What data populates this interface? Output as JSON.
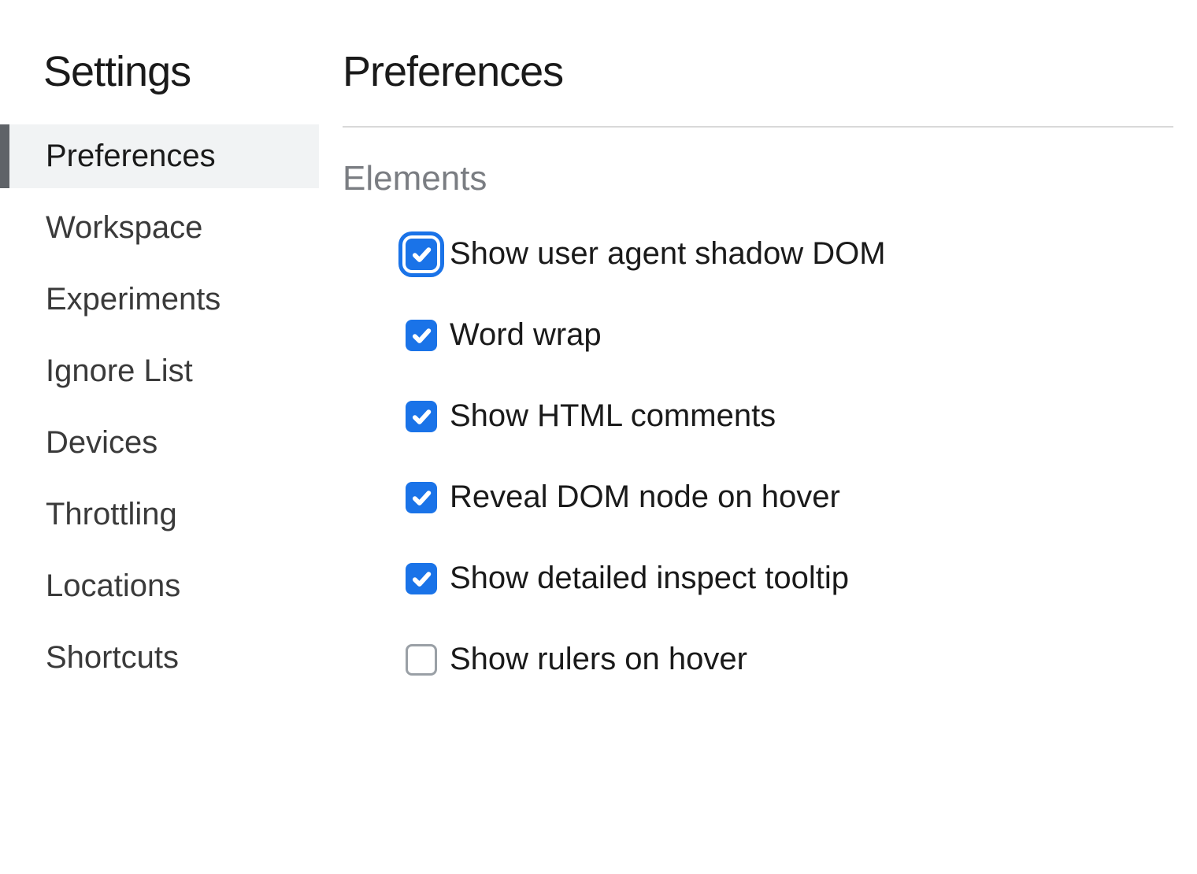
{
  "sidebar": {
    "title": "Settings",
    "items": [
      {
        "label": "Preferences",
        "selected": true
      },
      {
        "label": "Workspace",
        "selected": false
      },
      {
        "label": "Experiments",
        "selected": false
      },
      {
        "label": "Ignore List",
        "selected": false
      },
      {
        "label": "Devices",
        "selected": false
      },
      {
        "label": "Throttling",
        "selected": false
      },
      {
        "label": "Locations",
        "selected": false
      },
      {
        "label": "Shortcuts",
        "selected": false
      }
    ]
  },
  "main": {
    "title": "Preferences",
    "section_header": "Elements",
    "options": [
      {
        "label": "Show user agent shadow DOM",
        "checked": true,
        "focused": true
      },
      {
        "label": "Word wrap",
        "checked": true,
        "focused": false
      },
      {
        "label": "Show HTML comments",
        "checked": true,
        "focused": false
      },
      {
        "label": "Reveal DOM node on hover",
        "checked": true,
        "focused": false
      },
      {
        "label": "Show detailed inspect tooltip",
        "checked": true,
        "focused": false
      },
      {
        "label": "Show rulers on hover",
        "checked": false,
        "focused": false
      }
    ]
  },
  "colors": {
    "accent": "#1a73e8",
    "selected_bg": "#f1f3f4",
    "selected_indicator": "#5f6368",
    "divider": "#d9d9d9",
    "section_text": "#7a7d82",
    "checkbox_border": "#9aa0a6"
  }
}
